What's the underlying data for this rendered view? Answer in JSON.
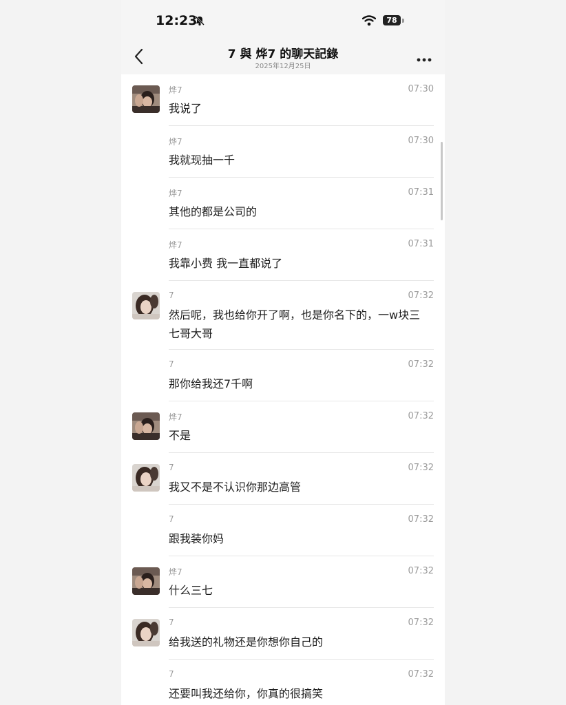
{
  "status": {
    "time": "12:23",
    "battery": "78"
  },
  "header": {
    "title": "7 與 烨7 的聊天記錄",
    "date": "2025年12月25日"
  },
  "icons": {
    "back": "chevron-left-icon",
    "more": "more-dots-icon",
    "mute": "bell-slash-icon",
    "wifi": "wifi-icon"
  },
  "messages": [
    {
      "sender": "烨7",
      "time": "07:30",
      "text": "我说了",
      "avatar": "a"
    },
    {
      "sender": "烨7",
      "time": "07:30",
      "text": "我就现抽一千",
      "avatar": ""
    },
    {
      "sender": "烨7",
      "time": "07:31",
      "text": "其他的都是公司的",
      "avatar": ""
    },
    {
      "sender": "烨7",
      "time": "07:31",
      "text": "我靠小费 我一直都说了",
      "avatar": ""
    },
    {
      "sender": "7",
      "time": "07:32",
      "text": "然后呢，我也给你开了啊，也是你名下的，一w块三七哥大哥",
      "avatar": "b"
    },
    {
      "sender": "7",
      "time": "07:32",
      "text": "那你给我还7千啊",
      "avatar": ""
    },
    {
      "sender": "烨7",
      "time": "07:32",
      "text": "不是",
      "avatar": "a"
    },
    {
      "sender": "7",
      "time": "07:32",
      "text": "我又不是不认识你那边高管",
      "avatar": "b"
    },
    {
      "sender": "7",
      "time": "07:32",
      "text": "跟我装你妈",
      "avatar": ""
    },
    {
      "sender": "烨7",
      "time": "07:32",
      "text": "什么三七",
      "avatar": "a"
    },
    {
      "sender": "7",
      "time": "07:32",
      "text": "给我送的礼物还是你想你自己的",
      "avatar": "b"
    },
    {
      "sender": "7",
      "time": "07:32",
      "text": "还要叫我还给你，你真的很搞笑",
      "avatar": ""
    }
  ]
}
